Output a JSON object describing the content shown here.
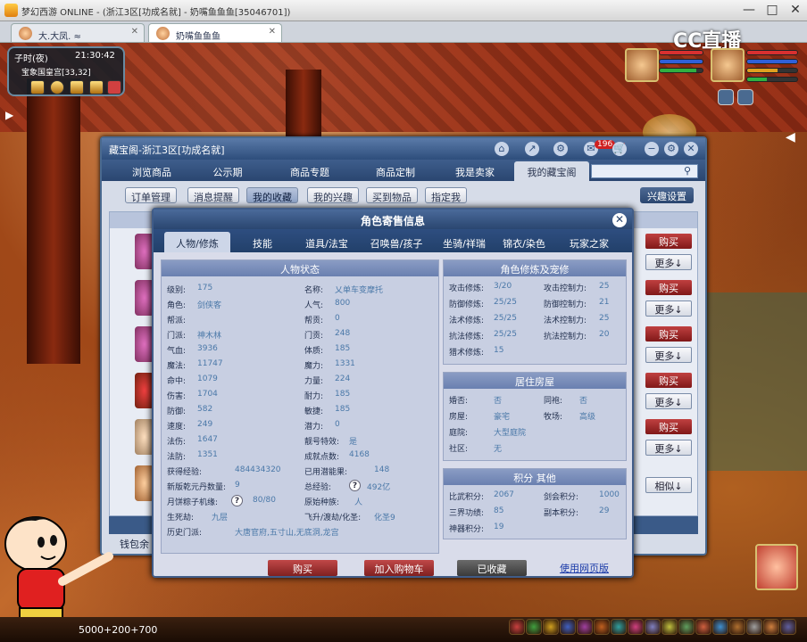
{
  "window": {
    "title": "梦幻西游 ONLINE - (浙江3区[功成名就] - 奶嘴鱼鱼鱼[35046701])",
    "controls": [
      "—",
      "□",
      "✕"
    ]
  },
  "browser_tabs": [
    {
      "label": "大.大凤.  ≈"
    },
    {
      "label": "奶嘴鱼鱼鱼"
    }
  ],
  "watermark": {
    "brand": "CC直播"
  },
  "minimap": {
    "time_of_day": "子时(夜)",
    "clock": "21:30:42",
    "location": "宝象国皇宫[33,32]"
  },
  "panel": {
    "title": "藏宝阁-浙江3区[功成名就]",
    "cart_count": "196",
    "nav_tabs": [
      "浏览商品",
      "公示期",
      "商品专题",
      "商品定制",
      "我是卖家",
      "我的藏宝阁"
    ],
    "active_nav": 5,
    "sub_tabs": [
      "订单管理",
      "消息提醒",
      "我的收藏",
      "我的兴趣",
      "买到物品",
      "指定我"
    ],
    "active_sub": 2,
    "interest_settings": "兴趣设置",
    "list_buttons": {
      "buy": "购买",
      "more": "更多↓",
      "similar": "相似↓"
    },
    "wallet_label": "钱包余"
  },
  "dialog": {
    "title": "角色寄售信息",
    "close": "✕",
    "tabs": [
      "人物/修炼",
      "技能",
      "道具/法宝",
      "召唤兽/孩子",
      "坐骑/祥瑞",
      "锦衣/染色",
      "玩家之家"
    ],
    "active_tab": 0,
    "status": {
      "header": "人物状态",
      "left": [
        {
          "k": "级别:",
          "v": "175"
        },
        {
          "k": "角色:",
          "v": "剑侠客"
        },
        {
          "k": "帮派:",
          "v": ""
        },
        {
          "k": "门派:",
          "v": "神木林"
        },
        {
          "k": "气血:",
          "v": "3936"
        },
        {
          "k": "魔法:",
          "v": "11747"
        },
        {
          "k": "命中:",
          "v": "1079"
        },
        {
          "k": "伤害:",
          "v": "1704"
        },
        {
          "k": "防御:",
          "v": "582"
        },
        {
          "k": "速度:",
          "v": "249"
        },
        {
          "k": "法伤:",
          "v": "1647"
        },
        {
          "k": "法防:",
          "v": "1351"
        }
      ],
      "right": [
        {
          "k": "名称:",
          "v": "乂单车变摩托"
        },
        {
          "k": "人气:",
          "v": "800"
        },
        {
          "k": "帮贡:",
          "v": "0"
        },
        {
          "k": "门贡:",
          "v": "248"
        },
        {
          "k": "体质:",
          "v": "185"
        },
        {
          "k": "魔力:",
          "v": "1331"
        },
        {
          "k": "力量:",
          "v": "224"
        },
        {
          "k": "耐力:",
          "v": "185"
        },
        {
          "k": "敏捷:",
          "v": "185"
        },
        {
          "k": "潜力:",
          "v": "0"
        },
        {
          "k": "靓号特效:",
          "v": "是"
        },
        {
          "k": "成就点数:",
          "v": "4168"
        }
      ],
      "extra": [
        {
          "k": "获得经验:",
          "v": "484434320",
          "k2": "已用潜能果:",
          "v2": "148"
        },
        {
          "k": "新版乾元丹数量:",
          "v": "9",
          "k2": "总经验:",
          "v2": "492亿"
        },
        {
          "k": "月饼粽子机缘:",
          "v": "80/80",
          "k2": "原始种族:",
          "v2": "人"
        },
        {
          "k": "生死劫:",
          "v": "九层",
          "k2": "飞升/渡劫/化圣:",
          "v2": "化圣9"
        },
        {
          "k": "历史门派:",
          "v": "大唐官府,五寸山,无底洞,龙宫",
          "k2": "",
          "v2": ""
        }
      ]
    },
    "cultivation": {
      "header": "角色修炼及宠修",
      "rows": [
        {
          "k": "攻击修炼:",
          "v": "3/20",
          "k2": "攻击控制力:",
          "v2": "25"
        },
        {
          "k": "防御修炼:",
          "v": "25/25",
          "k2": "防御控制力:",
          "v2": "21"
        },
        {
          "k": "法术修炼:",
          "v": "25/25",
          "k2": "法术控制力:",
          "v2": "25"
        },
        {
          "k": "抗法修炼:",
          "v": "25/25",
          "k2": "抗法控制力:",
          "v2": "20"
        },
        {
          "k": "猎术修炼:",
          "v": "15",
          "k2": "",
          "v2": ""
        }
      ]
    },
    "housing": {
      "header": "居住房屋",
      "rows": [
        {
          "k": "婚否:",
          "v": "否",
          "k2": "同袍:",
          "v2": "否"
        },
        {
          "k": "房屋:",
          "v": "豪宅",
          "k2": "牧场:",
          "v2": "高级"
        },
        {
          "k": "庭院:",
          "v": "大型庭院",
          "k2": "",
          "v2": ""
        },
        {
          "k": "社区:",
          "v": "无",
          "k2": "",
          "v2": ""
        }
      ]
    },
    "points": {
      "header": "积分 其他",
      "rows": [
        {
          "k": "比武积分:",
          "v": "2067",
          "k2": "剑会积分:",
          "v2": "1000"
        },
        {
          "k": "三界功绩:",
          "v": "85",
          "k2": "副本积分:",
          "v2": "29"
        },
        {
          "k": "神器积分:",
          "v": "19",
          "k2": "",
          "v2": ""
        }
      ]
    },
    "buttons": {
      "buy": "购买",
      "add_cart": "加入购物车",
      "collected": "已收藏",
      "web": "使用网页版"
    }
  },
  "bottom": {
    "coords": "5000+200+700"
  },
  "colors": {
    "accent": "#2a4670",
    "buy": "#a02828",
    "link": "#4a78a8"
  }
}
